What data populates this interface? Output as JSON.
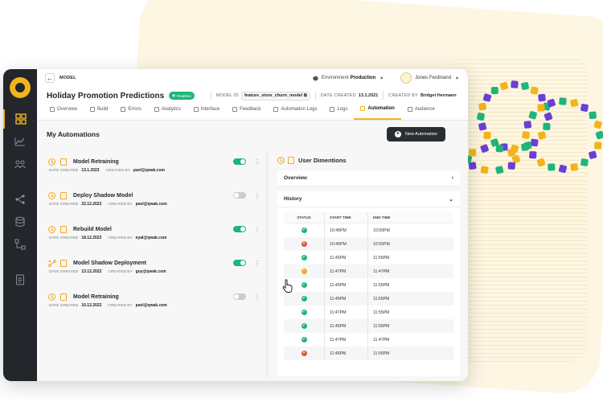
{
  "colors": {
    "accent": "#f2b31c",
    "success": "#1fb57a",
    "failed": "#e0523a",
    "sidebar": "#23262b",
    "decor_purple": "#6a3fd6",
    "decor_green": "#1fb57a",
    "decor_yellow": "#f2b31c"
  },
  "sidebar": {
    "logo": "qwak-logo-icon",
    "items": [
      {
        "icon": "dashboard-grid-icon",
        "active": true
      },
      {
        "icon": "chart-icon",
        "active": false
      },
      {
        "icon": "users-icon",
        "active": false
      },
      {
        "icon": "flow-icon",
        "active": false
      },
      {
        "icon": "database-icon",
        "active": false
      },
      {
        "icon": "deploy-icon",
        "active": false
      },
      {
        "icon": "document-icon",
        "active": false
      }
    ]
  },
  "topbar": {
    "breadcrumb": "MODEL",
    "environment_label": "Environment",
    "environment_value": "Production",
    "user_name": "Jones Ferdinand"
  },
  "model": {
    "title": "Holiday Promotion Predictions",
    "badge": "Realtime",
    "id_label": "MODEL ID",
    "id_value": "feature_store_churn_model",
    "date_label": "DATE CREATED",
    "date_value": "13.1.2021",
    "creator_label": "CREATED BY",
    "creator_value": "Bridget Hermann"
  },
  "tabs": [
    {
      "label": "Overview",
      "active": false
    },
    {
      "label": "Build",
      "active": false
    },
    {
      "label": "Errors",
      "active": false
    },
    {
      "label": "Analytics",
      "active": false
    },
    {
      "label": "Interface",
      "active": false
    },
    {
      "label": "Feedback",
      "active": false
    },
    {
      "label": "Automation Logs",
      "active": false
    },
    {
      "label": "Logs",
      "active": false
    },
    {
      "label": "Automation",
      "active": true
    },
    {
      "label": "Audience",
      "active": false
    }
  ],
  "automations_header": {
    "title": "My Automations",
    "new_button": "New Automation"
  },
  "automations": [
    {
      "name": "Model Retraining",
      "date_label": "DATE CREATED",
      "date": "13.1.2023",
      "creator_label": "CREATED BY",
      "creator": "pavl@qwak.com",
      "enabled": true,
      "icon": "clock-icon"
    },
    {
      "name": "Deploy Shadow Model",
      "date_label": "DATE CREATED",
      "date": "22.12.2022",
      "creator_label": "CREATED BY",
      "creator": "pavl@qwak.com",
      "enabled": false,
      "icon": "clock-icon"
    },
    {
      "name": "Rebuild Model",
      "date_label": "DATE CREATED",
      "date": "18.12.2022",
      "creator_label": "CREATED BY",
      "creator": "eyal@qwak.com",
      "enabled": true,
      "icon": "clock-icon"
    },
    {
      "name": "Model Shadow Deployment",
      "date_label": "DATE CREATED",
      "date": "13.12.2022",
      "creator_label": "CREATED BY",
      "creator": "guy@qwak.com",
      "enabled": true,
      "icon": "route-icon"
    },
    {
      "name": "Model Retraining",
      "date_label": "DATE CREATED",
      "date": "10.12.2022",
      "creator_label": "CREATED BY",
      "creator": "pavl@qwak.com",
      "enabled": false,
      "icon": "clock-icon"
    }
  ],
  "panel": {
    "title": "User Dimentions",
    "overview_label": "Overview",
    "history_label": "History",
    "columns": [
      "STATUS",
      "START TIME",
      "END TIME"
    ],
    "rows": [
      {
        "status": "success",
        "start": "10:45PM",
        "end": "10:50PM"
      },
      {
        "status": "failed",
        "start": "10:45PM",
        "end": "10:55PM"
      },
      {
        "status": "success",
        "start": "11:45PM",
        "end": "11:55PM"
      },
      {
        "status": "running",
        "start": "11:47PM",
        "end": "11:47PM"
      },
      {
        "status": "success",
        "start": "11:45PM",
        "end": "11:55PM"
      },
      {
        "status": "success",
        "start": "11:45PM",
        "end": "11:55PM"
      },
      {
        "status": "success",
        "start": "11:47PM",
        "end": "11:55PM"
      },
      {
        "status": "success",
        "start": "11:45PM",
        "end": "11:55PM"
      },
      {
        "status": "success",
        "start": "11:47PM",
        "end": "11:47PM"
      },
      {
        "status": "failed",
        "start": "11:45PM",
        "end": "11:55PM"
      }
    ]
  }
}
